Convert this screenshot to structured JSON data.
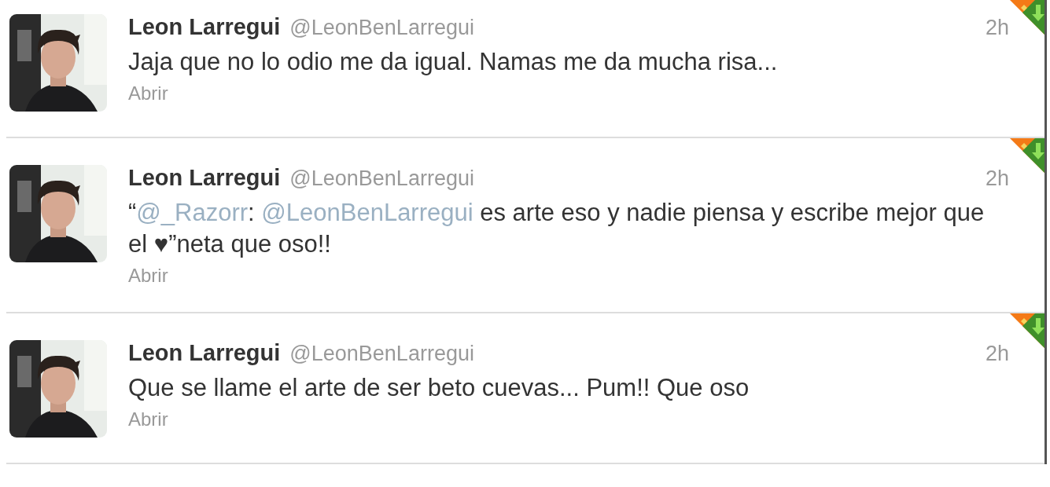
{
  "tweets": [
    {
      "name": "Leon Larregui",
      "handle": "@LeonBenLarregui",
      "time": "2h",
      "text": [
        {
          "kind": "plain",
          "text": "Jaja que no lo odio me da igual. Namas me da mucha risa..."
        }
      ],
      "action": "Abrir"
    },
    {
      "name": "Leon Larregui",
      "handle": "@LeonBenLarregui",
      "time": "2h",
      "text": [
        {
          "kind": "plain",
          "text": "“"
        },
        {
          "kind": "mention",
          "text": "@_Razorr"
        },
        {
          "kind": "plain",
          "text": ": "
        },
        {
          "kind": "mention",
          "text": "@LeonBenLarregui"
        },
        {
          "kind": "plain",
          "text": " es arte eso y nadie piensa y escribe mejor que el ♥”neta que oso!!"
        }
      ],
      "action": "Abrir"
    },
    {
      "name": "Leon Larregui",
      "handle": "@LeonBenLarregui",
      "time": "2h",
      "text": [
        {
          "kind": "plain",
          "text": "Que se llame el arte de ser beto cuevas... Pum!! Que oso"
        }
      ],
      "action": "Abrir"
    }
  ]
}
